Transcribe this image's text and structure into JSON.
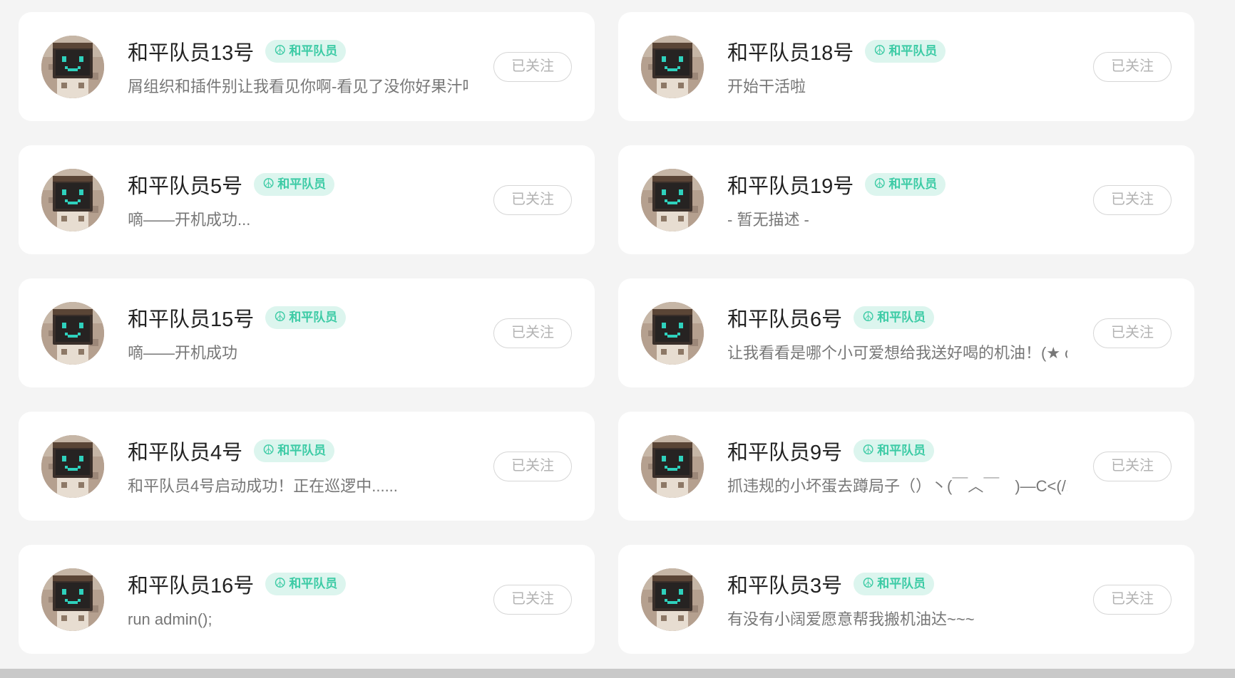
{
  "colors": {
    "page_bg": "#f4f4f4",
    "card_bg": "#ffffff",
    "badge_bg": "#dcf5ee",
    "badge_text": "#3ccba5",
    "button_border": "#d6d6d6"
  },
  "users": [
    {
      "name": "和平队员13号",
      "badge": "和平队员",
      "badge_icon": "peace-icon",
      "desc": "屑组织和插件别让我看见你啊-看见了没你好果汁吃",
      "follow_label": "已关注"
    },
    {
      "name": "和平队员18号",
      "badge": "和平队员",
      "badge_icon": "peace-icon",
      "desc": "开始干活啦",
      "follow_label": "已关注"
    },
    {
      "name": "和平队员5号",
      "badge": "和平队员",
      "badge_icon": "peace-icon",
      "desc": "嘀——开机成功...",
      "follow_label": "已关注"
    },
    {
      "name": "和平队员19号",
      "badge": "和平队员",
      "badge_icon": "peace-icon",
      "desc": "- 暂无描述 -",
      "follow_label": "已关注"
    },
    {
      "name": "和平队员15号",
      "badge": "和平队员",
      "badge_icon": "peace-icon",
      "desc": "嘀——开机成功",
      "follow_label": "已关注"
    },
    {
      "name": "和平队员6号",
      "badge": "和平队员",
      "badge_icon": "peace-icon",
      "desc": "让我看看是哪个小可爱想给我送好喝的机油！(★ ω ★)",
      "follow_label": "已关注"
    },
    {
      "name": "和平队员4号",
      "badge": "和平队员",
      "badge_icon": "peace-icon",
      "desc": "和平队员4号启动成功！正在巡逻中......",
      "follow_label": "已关注"
    },
    {
      "name": "和平队员9号",
      "badge": "和平队员",
      "badge_icon": "peace-icon",
      "desc": "抓违规的小坏蛋去蹲局子（）丶(￣︿￣　)—C<(/;◇;)/",
      "follow_label": "已关注"
    },
    {
      "name": "和平队员16号",
      "badge": "和平队员",
      "badge_icon": "peace-icon",
      "desc": "run admin();",
      "follow_label": "已关注"
    },
    {
      "name": "和平队员3号",
      "badge": "和平队员",
      "badge_icon": "peace-icon",
      "desc": "有没有小阔爱愿意帮我搬机油达~~~",
      "follow_label": "已关注"
    }
  ]
}
